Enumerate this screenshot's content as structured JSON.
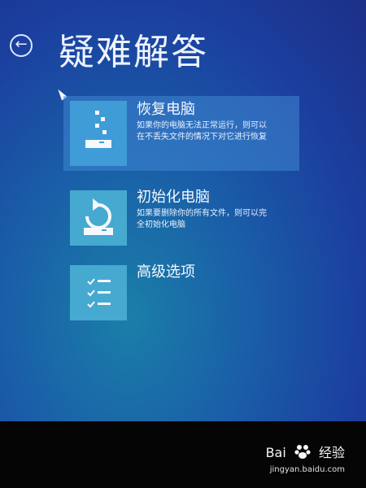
{
  "header": {
    "title": "疑难解答",
    "back_icon": "back-arrow-icon"
  },
  "options": [
    {
      "title": "恢复电脑",
      "description": "如果你的电脑无法正常运行，则可以\n在不丢失文件的情况下对它进行恢复",
      "icon": "refresh-pc-icon",
      "selected": true
    },
    {
      "title": "初始化电脑",
      "description": "如果要删除你的所有文件，则可以完\n全初始化电脑",
      "icon": "reset-pc-icon",
      "selected": false
    },
    {
      "title": "高级选项",
      "description": "",
      "icon": "advanced-options-icon",
      "selected": false
    }
  ],
  "watermark": {
    "brand": "Bai",
    "brand2": "经验",
    "url": "jingyan.baidu.com"
  },
  "colors": {
    "background": "#1b4fa8",
    "tile": "#46a9cf",
    "selected_tile": "#3f9cd6",
    "selected_background": "#4087d2"
  }
}
